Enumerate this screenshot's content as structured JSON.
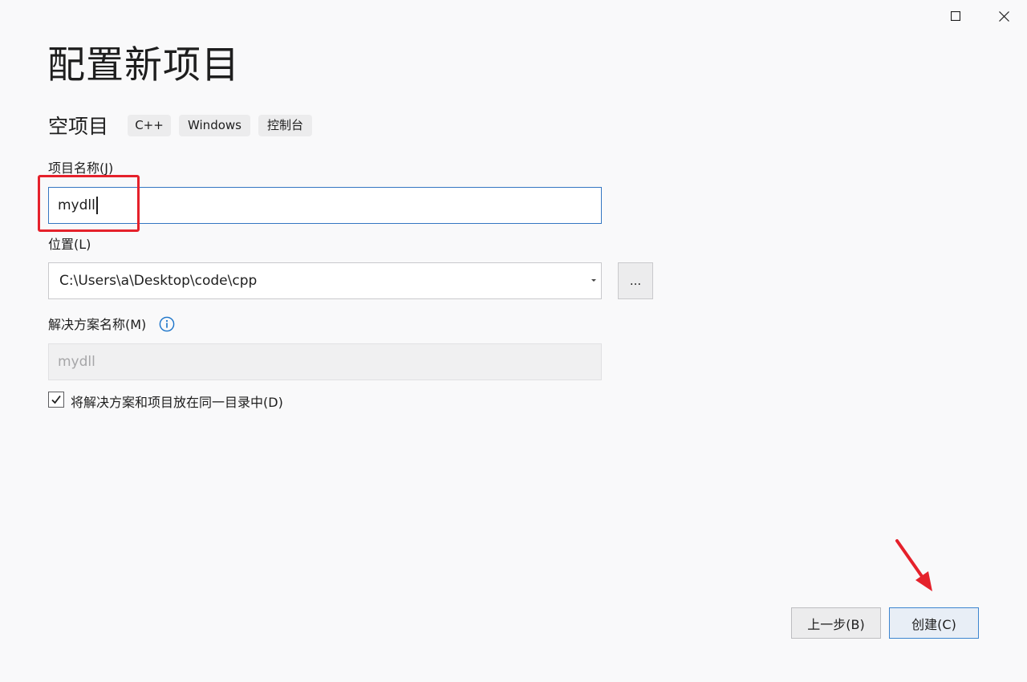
{
  "window": {
    "maximize_icon": "maximize-icon",
    "close_icon": "close-icon"
  },
  "title": "配置新项目",
  "template": {
    "name": "空项目",
    "tags": [
      "C++",
      "Windows",
      "控制台"
    ]
  },
  "project_name": {
    "label": "项目名称(J)",
    "value": "mydll"
  },
  "location": {
    "label": "位置(L)",
    "value": "C:\\Users\\a\\Desktop\\code\\cpp",
    "browse_label": "..."
  },
  "solution_name": {
    "label": "解决方案名称(M)",
    "value": "mydll",
    "info_icon": "info-icon"
  },
  "same_directory": {
    "label": "将解决方案和项目放在同一目录中(D)",
    "checked": true
  },
  "buttons": {
    "back": "上一步(B)",
    "create": "创建(C)"
  },
  "annotations": {
    "highlight_color": "#e5212b",
    "arrow_color": "#e5212b"
  },
  "colors": {
    "background": "#f9f9fa",
    "focus_border": "#3476c2",
    "primary_border": "#3c85d0",
    "info_blue": "#1a73c9"
  }
}
